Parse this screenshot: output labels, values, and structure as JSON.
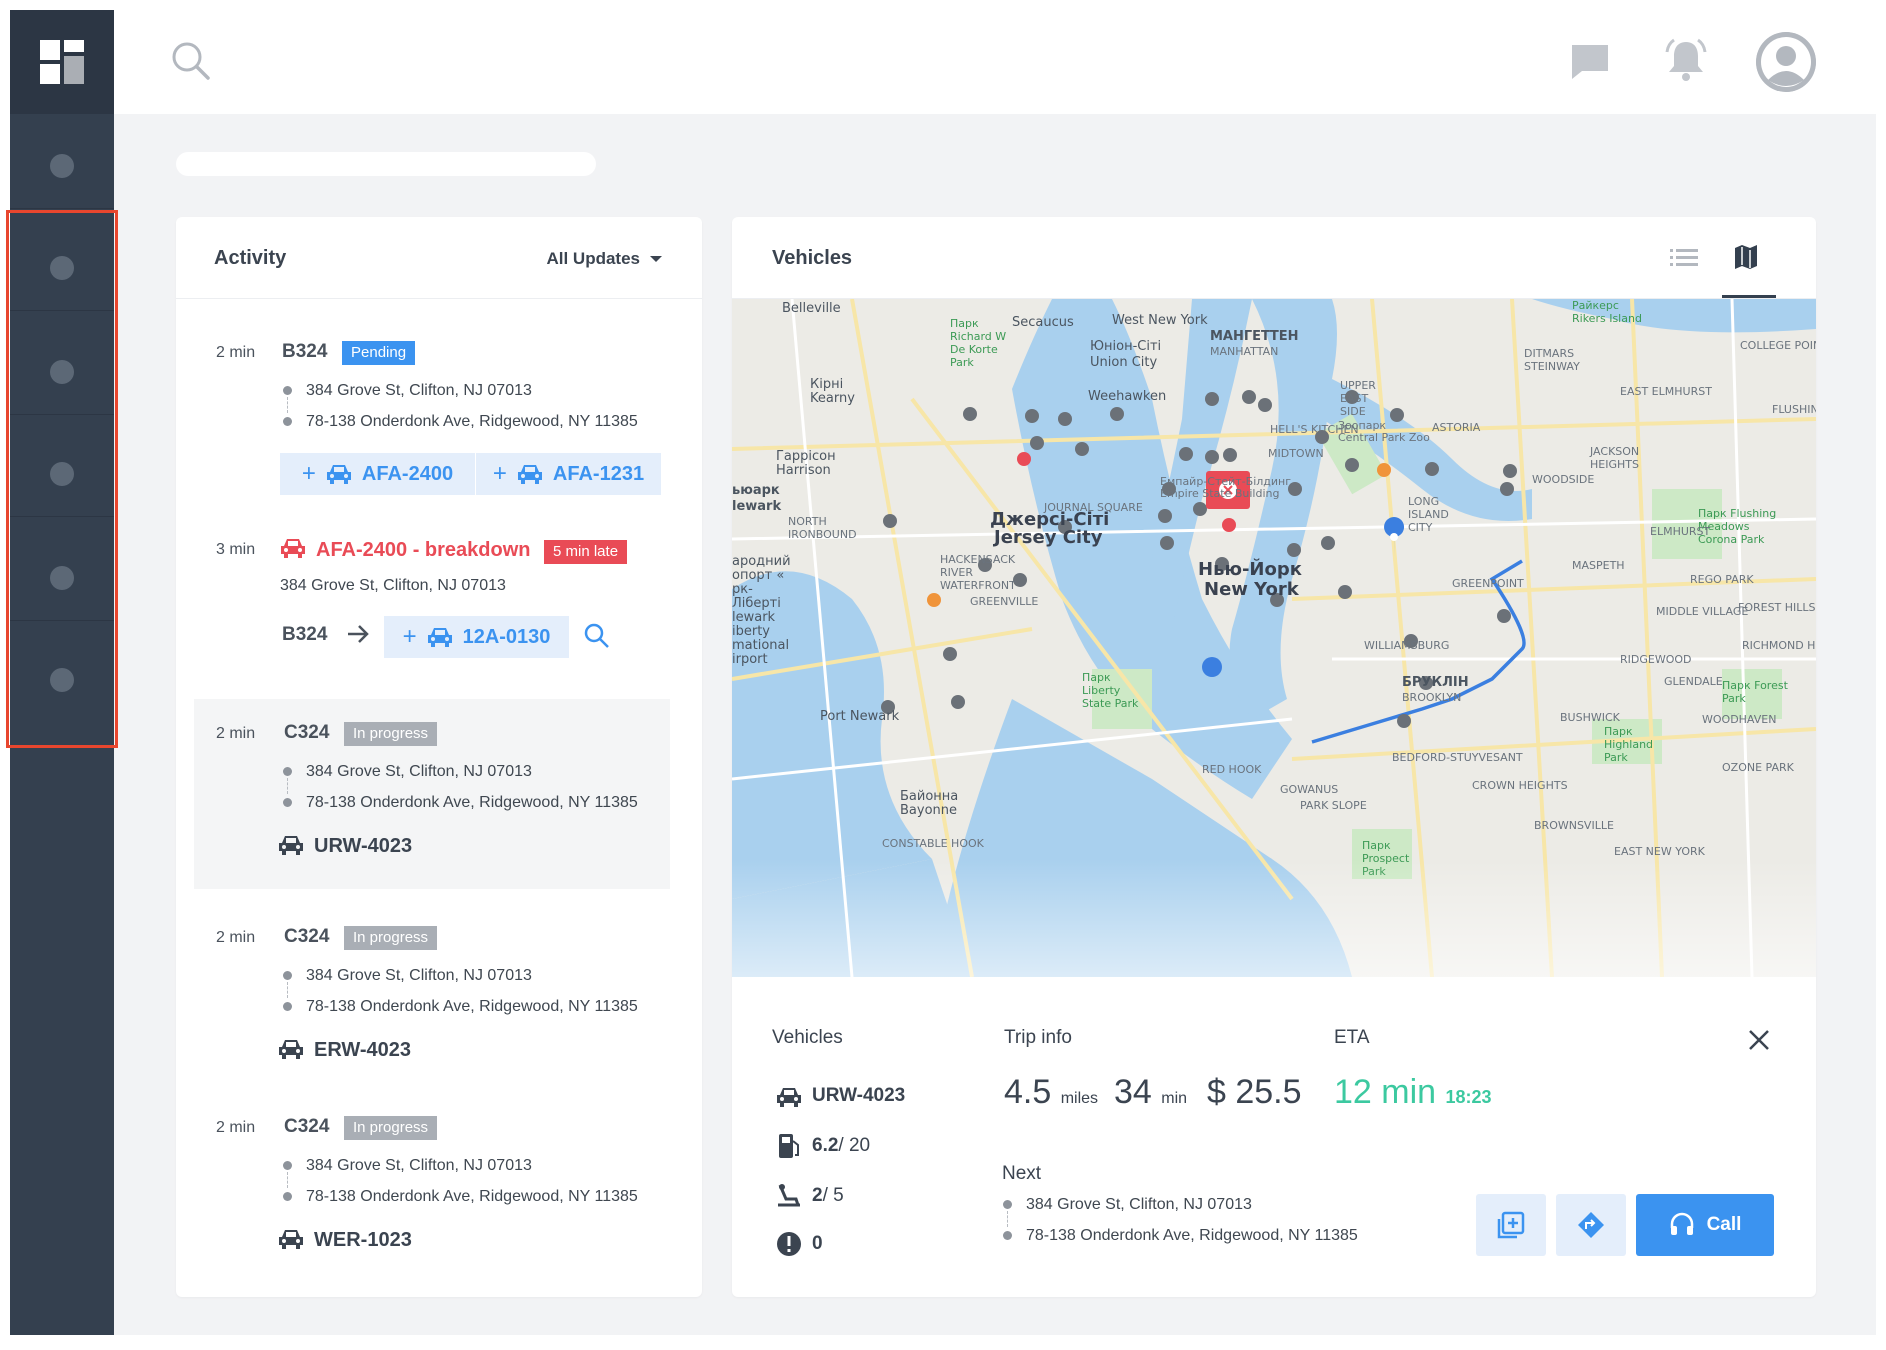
{
  "topbar": {
    "icons": [
      "search-icon",
      "chat-icon",
      "bell-icon",
      "avatar"
    ]
  },
  "sidebar": {
    "items": [
      "nav-1",
      "nav-2",
      "nav-3",
      "nav-4",
      "nav-5",
      "nav-6"
    ]
  },
  "activity": {
    "title": "Activity",
    "filter_label": "All Updates",
    "entries": [
      {
        "time": "2 min",
        "code": "B324",
        "status": "Pending",
        "from": "384 Grove St, Clifton, NJ 07013",
        "to": "78-138 Onderdonk Ave, Ridgewood, NY 11385",
        "assign": [
          "AFA-2400",
          "AFA-1231"
        ]
      },
      {
        "time": "3 min",
        "alert": "AFA-2400 - breakdown",
        "late": "5 min late",
        "address": "384 Grove St, Clifton, NJ 07013",
        "reassign_from": "B324",
        "reassign_to": "12A-0130"
      },
      {
        "time": "2 min",
        "code": "C324",
        "status": "In progress",
        "from": "384 Grove St, Clifton, NJ 07013",
        "to": "78-138 Onderdonk Ave, Ridgewood, NY 11385",
        "vehicle": "URW-4023"
      },
      {
        "time": "2 min",
        "code": "C324",
        "status": "In progress",
        "from": "384 Grove St, Clifton, NJ 07013",
        "to": "78-138 Onderdonk Ave, Ridgewood, NY 11385",
        "vehicle": "ERW-4023"
      },
      {
        "time": "2 min",
        "code": "C324",
        "status": "In progress",
        "from": "384 Grove St, Clifton, NJ 07013",
        "to": "78-138 Onderdonk Ave, Ridgewood, NY 11385",
        "vehicle": "WER-1023"
      }
    ]
  },
  "vehicles": {
    "title": "Vehicles",
    "map_labels": {
      "belleville": "Belleville",
      "secaucus": "Secaucus",
      "west_new_york": "West New York",
      "manhattan_uk": "МАНГЕТТЕН",
      "manhattan": "MANHATTAN",
      "union_city_uk": "Юніон-Сіті",
      "union_city": "Union City",
      "weehawken": "Weehawken",
      "kearny_uk": "Кірні",
      "kearny": "Kearny",
      "harrison_uk": "Гаррісон",
      "harrison": "Harrison",
      "newark_uk": "ьюарк",
      "newark": "lewark",
      "jersey_city_uk": "Джерсі-Сіті",
      "jersey_city": "Jersey City",
      "new_york_uk": "Нью-Йорк",
      "new_york": "New York",
      "brooklyn_uk": "БРУКЛІН",
      "brooklyn": "BROOKLYN",
      "port_newark": "Port Newark",
      "bayonne_uk": "Байонна",
      "bayonne": "Bayonne",
      "empire_state": "Емпайр-Стейт-Білдинг",
      "empire_state_en": "Empire State Building",
      "central_park_zoo": "Зоопарк",
      "central_park_zoo_en": "Central Park Zoo",
      "astoria": "ASTORIA",
      "park_liberty": "Парк Liberty State Park",
      "park_flushing": "Парк Flushing Meadows Corona Park",
      "park_forest": "Парк Forest Park",
      "park_highland": "Парк Highland Park",
      "park_prospect": "Парк Prospect Park",
      "greenpoint": "GREENPOINT",
      "williamsburg": "WILLIAMSBURG",
      "long_island_city": "LONG ISLAND CITY",
      "maspeth": "MASPETH",
      "ridgewood": "RIDGEWOOD",
      "bushwick": "BUSHWICK",
      "bedford": "BEDFORD-STUYVESANT",
      "red_hook": "RED HOOK",
      "gowanus": "GOWANUS",
      "park_slope": "PARK SLOPE",
      "crown_heights": "CROWN HEIGHTS",
      "greenville": "GREENVILLE",
      "hackensack": "HACKENSACK RIVER WATERFRONT",
      "journal_square": "JOURNAL SQUARE",
      "north_ironbound": "NORTH IRONBOUND",
      "middle_village": "MIDDLE VILLAGE",
      "glendale": "GLENDALE",
      "woodhaven": "WOODHAVEN",
      "ozone_park": "OZONE PARK",
      "east_new_york": "EAST NEW YORK",
      "brownsville": "BROWNSVILLE",
      "jackson_heights": "JACKSON HEIGHTS",
      "elmhurst": "ELMHURST",
      "east_elmhurst": "EAST ELMHURST",
      "woodside": "WOODSIDE",
      "rego_park": "REGO PARK",
      "forest_hills": "FOREST HILLS",
      "richmond_hill": "RICHMOND HILL",
      "flushing": "FLUSHING",
      "college_point": "COLLEGE POINT",
      "upper_east_side": "UPPER EAST SIDE",
      "midtown": "MIDTOWN",
      "hells_kitchen": "HELL'S KITCHEN",
      "ditmars": "DITMARS STEINWAY",
      "constable_hook": "CONSTABLE HOOK",
      "airport": "ародний опорт « рк-Ліберті lewark iberty mational irport",
      "park_richard": "Парк Richard W De Korte Park",
      "park_rikers": "Райкерс Rikers Island"
    },
    "detail": {
      "col_vehicles": "Vehicles",
      "col_trip": "Trip info",
      "col_eta": "ETA",
      "vehicle": "URW-4023",
      "fuel": "6.2",
      "fuel_total": "/ 20",
      "seats": "2",
      "seats_total": "/ 5",
      "alerts": "0",
      "miles": "4.5",
      "miles_unit": "miles",
      "minutes": "34",
      "minutes_unit": "min",
      "price": "$ 25.5",
      "eta": "12 min",
      "eta_time": "18:23",
      "next_label": "Next",
      "next_from": "384 Grove St, Clifton, NJ 07013",
      "next_to": "78-138 Onderdonk Ave, Ridgewood, NY 11385",
      "call_label": "Call"
    }
  },
  "colors": {
    "sidebar": "#34404f",
    "accent": "#3b93f0",
    "danger": "#e94b56",
    "success": "#3cc9a0",
    "highlight": "#e8462e"
  }
}
